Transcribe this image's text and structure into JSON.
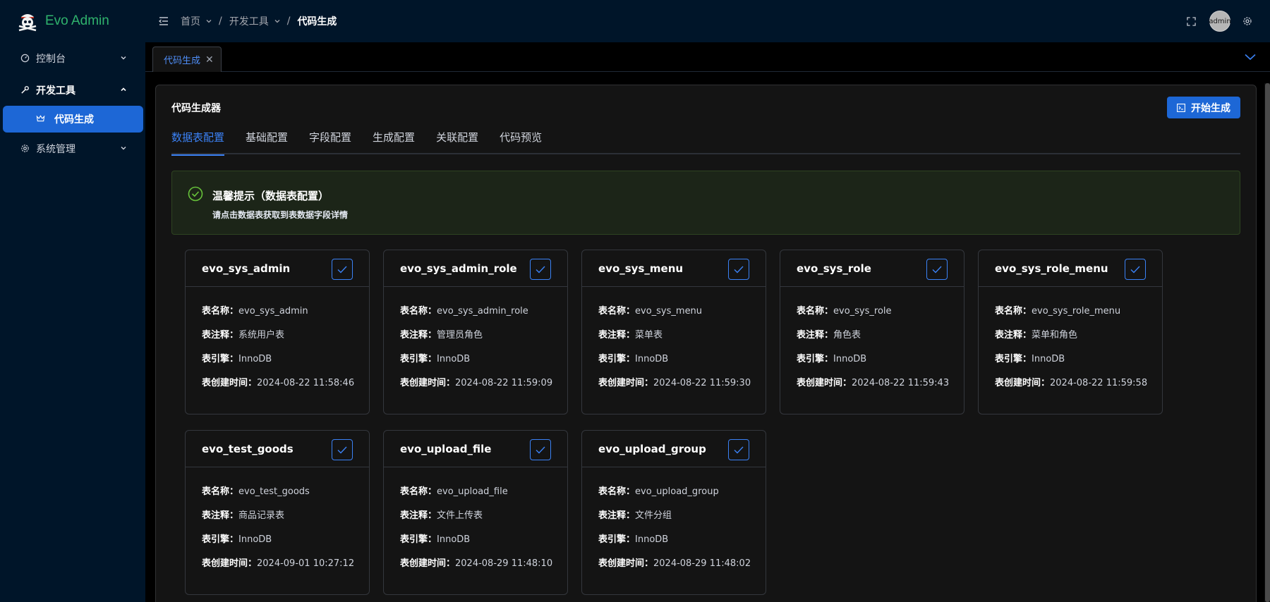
{
  "app": {
    "title": "Evo Admin",
    "brand_color": "#2fb36d",
    "accent": "#1d67d6"
  },
  "sidebar": {
    "items": [
      {
        "label": "控制台",
        "icon": "dashboard-icon",
        "expanded": false
      },
      {
        "label": "开发工具",
        "icon": "wrench-icon",
        "expanded": true
      },
      {
        "label": "系统管理",
        "icon": "gear-icon",
        "expanded": false
      }
    ],
    "active_sub": {
      "label": "代码生成",
      "icon": "crown-icon"
    }
  },
  "header": {
    "breadcrumb": [
      {
        "label": "首页"
      },
      {
        "label": "开发工具"
      },
      {
        "label": "代码生成"
      }
    ],
    "separator": "/",
    "user": "admin"
  },
  "tabs": [
    {
      "label": "代码生成",
      "close": "✕"
    }
  ],
  "panel": {
    "title": "代码生成器",
    "start_button": "开始生成",
    "config_tabs": [
      "数据表配置",
      "基础配置",
      "字段配置",
      "生成配置",
      "关联配置",
      "代码预览"
    ],
    "active_tab": 0,
    "alert": {
      "title": "温馨提示（数据表配置）",
      "description": "请点击数据表获取到表数据字段详情"
    },
    "labels": {
      "name": "表名称：",
      "comment": "表注释：",
      "engine": "表引擎：",
      "created": "表创建时间："
    },
    "tables": [
      {
        "name": "evo_sys_admin",
        "comment": "系统用户表",
        "engine": "InnoDB",
        "created": "2024-08-22 11:58:46",
        "checked": true
      },
      {
        "name": "evo_sys_admin_role",
        "comment": "管理员角色",
        "engine": "InnoDB",
        "created": "2024-08-22 11:59:09",
        "checked": true
      },
      {
        "name": "evo_sys_menu",
        "comment": "菜单表",
        "engine": "InnoDB",
        "created": "2024-08-22 11:59:30",
        "checked": true
      },
      {
        "name": "evo_sys_role",
        "comment": "角色表",
        "engine": "InnoDB",
        "created": "2024-08-22 11:59:43",
        "checked": true
      },
      {
        "name": "evo_sys_role_menu",
        "comment": "菜单和角色",
        "engine": "InnoDB",
        "created": "2024-08-22 11:59:58",
        "checked": true
      },
      {
        "name": "evo_test_goods",
        "comment": "商品记录表",
        "engine": "InnoDB",
        "created": "2024-09-01 10:27:12",
        "checked": true
      },
      {
        "name": "evo_upload_file",
        "comment": "文件上传表",
        "engine": "InnoDB",
        "created": "2024-08-29 11:48:10",
        "checked": true
      },
      {
        "name": "evo_upload_group",
        "comment": "文件分组",
        "engine": "InnoDB",
        "created": "2024-08-29 11:48:02",
        "checked": true
      }
    ]
  }
}
